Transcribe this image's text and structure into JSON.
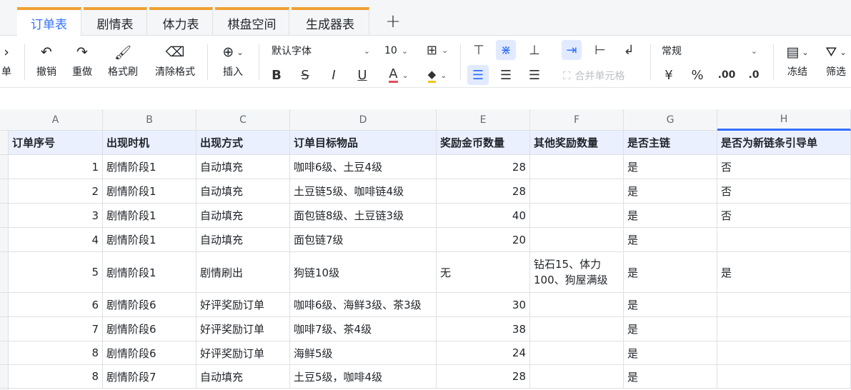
{
  "tabs": [
    {
      "label": "订单表",
      "active": true
    },
    {
      "label": "剧情表"
    },
    {
      "label": "体力表"
    },
    {
      "label": "棋盘空间"
    },
    {
      "label": "生成器表"
    }
  ],
  "tab_add": "+",
  "toolbar": {
    "cut_label": "单",
    "undo": "撤销",
    "redo": "重做",
    "format_painter": "格式刷",
    "clear_format": "清除格式",
    "insert": "插入",
    "font": "默认字体",
    "font_size": "10",
    "bold": "B",
    "strike": "S",
    "italic": "I",
    "underline": "U",
    "font_color": "A",
    "merge": "合并单元格",
    "number_format": "常规",
    "currency": "¥",
    "percent": "%",
    "inc_decimal": ".00",
    "dec_decimal": ".0",
    "freeze": "冻结",
    "filter": "筛选"
  },
  "columns": [
    "A",
    "B",
    "C",
    "D",
    "E",
    "F",
    "G",
    "H"
  ],
  "header_row": [
    "订单序号",
    "出现时机",
    "出现方式",
    "订单目标物品",
    "奖励金币数量",
    "其他奖励数量",
    "是否主链",
    "是否为新链条引导单"
  ],
  "rows": [
    [
      "1",
      "剧情阶段1",
      "自动填充",
      "咖啡6级、土豆4级",
      "28",
      "",
      "是",
      "否"
    ],
    [
      "2",
      "剧情阶段1",
      "自动填充",
      "土豆链5级、咖啡链4级",
      "28",
      "",
      "是",
      "否"
    ],
    [
      "3",
      "剧情阶段1",
      "自动填充",
      "面包链8级、土豆链3级",
      "40",
      "",
      "是",
      "否"
    ],
    [
      "4",
      "剧情阶段1",
      "自动填充",
      "面包链7级",
      "20",
      "",
      "是",
      ""
    ],
    [
      "5",
      "剧情阶段1",
      "剧情刷出",
      "狗链10级",
      "无",
      "钻石15、体力100、狗屋满级",
      "是",
      "是"
    ],
    [
      "6",
      "剧情阶段6",
      "好评奖励订单",
      "咖啡6级、海鲜3级、茶3级",
      "30",
      "",
      "是",
      ""
    ],
    [
      "7",
      "剧情阶段6",
      "好评奖励订单",
      "咖啡7级、茶4级",
      "38",
      "",
      "是",
      ""
    ],
    [
      "8",
      "剧情阶段6",
      "好评奖励订单",
      "海鲜5级",
      "24",
      "",
      "是",
      ""
    ],
    [
      "8",
      "剧情阶段7",
      "自动填充",
      "土豆5级，咖啡4级",
      "28",
      "",
      "是",
      ""
    ]
  ]
}
